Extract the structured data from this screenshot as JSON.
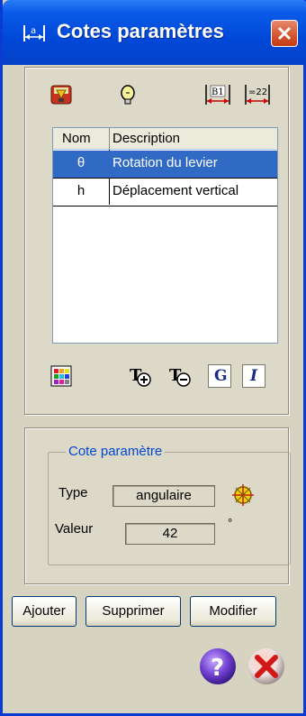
{
  "window": {
    "title": "Cotes paramètres"
  },
  "list": {
    "headers": {
      "nom": "Nom",
      "description": "Description"
    },
    "rows": [
      {
        "nom": "θ",
        "description": "Rotation du levier",
        "selected": true
      },
      {
        "nom": "h",
        "description": "Déplacement vertical",
        "selected": false
      }
    ]
  },
  "toolbar_top": {
    "icons": [
      "import-icon",
      "bulb-icon",
      "dimension-b1-icon",
      "dimension-value-icon"
    ],
    "b1_label": "B1",
    "v22_label": "=22"
  },
  "toolbar_bottom": {
    "icons": [
      "color-grid-icon",
      "font-increase-icon",
      "font-decrease-icon",
      "bold-icon",
      "italic-icon"
    ],
    "bold_label": "G",
    "italic_label": "I"
  },
  "parameter": {
    "group_label": "Cote paramètre",
    "type_label": "Type",
    "type_value": "angulaire",
    "value_label": "Valeur",
    "value": "42",
    "unit": "°"
  },
  "buttons": {
    "add": "Ajouter",
    "delete": "Supprimer",
    "modify": "Modifier"
  },
  "colors": {
    "titlebar": "#0054e3",
    "selection": "#316ac5",
    "legend": "#0046d5"
  }
}
